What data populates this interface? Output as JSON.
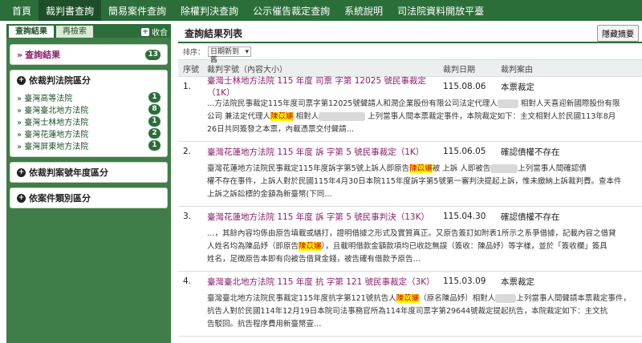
{
  "topnav": [
    "首頁",
    "裁判書查詢",
    "簡易案件查詢",
    "除權判決查詢",
    "公示催告裁定查詢",
    "系統說明",
    "司法院資料開放平臺"
  ],
  "left": {
    "tab_results": "查詢結果",
    "tab_research": "再檢索",
    "collapse": "收合",
    "result_label": "查詢結果",
    "result_count": "13",
    "court_section": "依裁判法院區分",
    "courts": [
      {
        "name": "臺灣高等法院",
        "count": "1"
      },
      {
        "name": "臺灣臺北地方法院",
        "count": "8"
      },
      {
        "name": "臺灣士林地方法院",
        "count": "1"
      },
      {
        "name": "臺灣花蓮地方法院",
        "count": "2"
      },
      {
        "name": "臺灣屏東地方法院",
        "count": "1"
      }
    ],
    "year_section": "依裁判案號年度區分",
    "category_section": "依案件類別區分"
  },
  "main": {
    "title": "查詢結果列表",
    "hide_summary": "隱藏摘要",
    "sort_label": "排序：",
    "sort_value": "日期新到舊",
    "col_no": "序號",
    "col_title": "裁判字號（內容大小）",
    "col_date": "裁判日期",
    "col_reason": "裁判案由",
    "rows": [
      {
        "no": "1.",
        "title": "臺灣士林地方法院 115 年度 司票 字第 12025 號民事裁定",
        "size": "（1K）",
        "date": "115.08.06",
        "reason": "本票裁定",
        "s1": "…方法院民事裁定115年度司票字第12025號聲請人和潤企業股份有限公司法定代理人",
        "s2": "相對人天喜迎新國際股份有限",
        "s3": "公司 兼法定代理人",
        "hl": "陳苡孋",
        "s4": "相對人",
        "s5": "上列當事人間本票裁定事件，本院裁定如下：主文相對人於民國113年8月",
        "s6": "26日共同簽發之本票，內載憑票交付聲請…"
      },
      {
        "no": "2.",
        "title": "臺灣花蓮地方法院 115 年度 訴 字第 5 號民事裁定",
        "size": "（1K）",
        "date": "115.06.05",
        "reason": "確認債權不存在",
        "s1": "臺灣花蓮地方法院民事裁定115年度訴字第5號上訴人即原告",
        "hl": "陳苡孋",
        "s2": "被 上訴 人即被告",
        "s3": "上列當事人間確認債",
        "s4": "權不存在事件，上訴人對於民國115年4月30日本院115年度訴字第5號第一審判決提起上訴，惟未繳納上訴裁判費。查本件",
        "s5": "上訴之訴訟標的金額為新臺幣(下同…"
      },
      {
        "no": "3.",
        "title": "臺灣花蓮地方法院 115 年度 訴 字第 5 號民事判決",
        "size": "（13K）",
        "date": "115.04.30",
        "reason": "確認債權不存在",
        "s1": "…，其餘內容均係由原告填載或繕打，證明借據之形式及實質真正。又原告簽訂如附表1所示之系爭借據，記載內容之借貸",
        "s2": "人姓名均為陳品妤（即原告",
        "hl": "陳苡孋",
        "s3": "），且載明借款金額款項均已收訖無誤（簽收：陳品妤）等字樣，並於「簽收欄」簽具",
        "s4": "姓名，足徵原告本即有向被告借貸金錢，被告確有借款予原告…"
      },
      {
        "no": "4.",
        "title": "臺灣臺北地方法院 115 年度 抗 字第 121 號民事裁定",
        "size": "（3K）",
        "date": "115.03.09",
        "reason": "本票裁定",
        "s1": "臺灣臺北地方法院民事裁定115年度抗字第121號抗告人",
        "hl": "陳苡孋",
        "s2": "（原名陳品妤）相對人",
        "s3": "上列當事人間聲請本票裁定事件，抗告人對於民國114年12月19日本院司法事務官所為114年度司票字第29644號裁定提起抗告，本院裁定如下：主文抗",
        "s4": "告駁回。抗告程序費用新臺幣壹…"
      }
    ]
  }
}
